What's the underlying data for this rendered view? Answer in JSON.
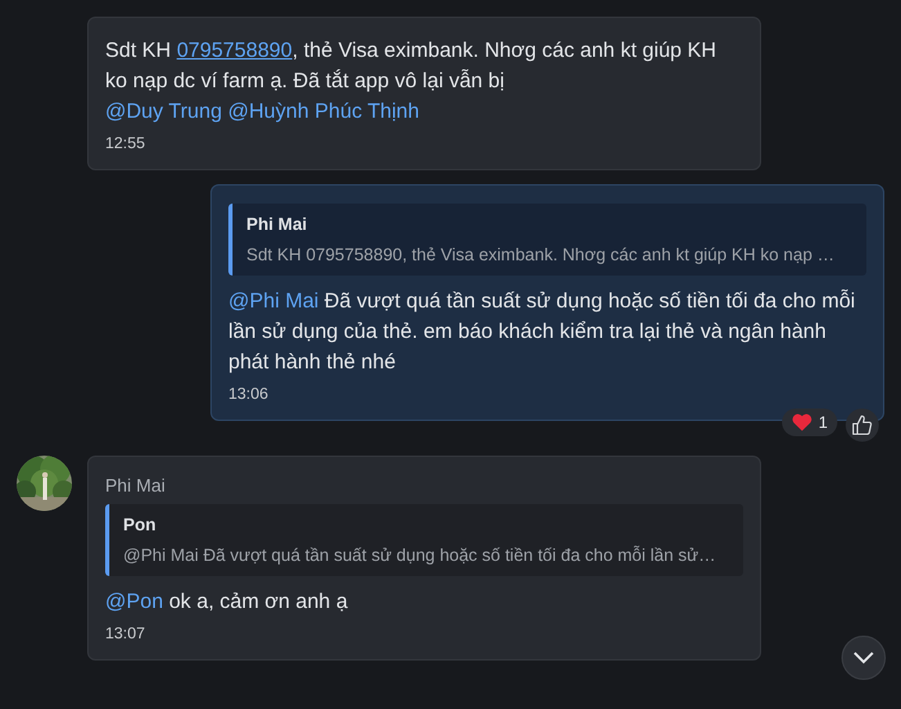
{
  "messages": [
    {
      "kind": "incoming",
      "parts": [
        {
          "kind": "plain",
          "text": "Sdt KH "
        },
        {
          "kind": "link",
          "text": "0795758890"
        },
        {
          "kind": "plain",
          "text": ", thẻ Visa eximbank. Nhơg các anh kt giúp KH ko nạp dc ví farm ạ. Đã tắt app vô lại vẫn bị "
        },
        {
          "kind": "mention",
          "text": "@Duy Trung"
        },
        {
          "kind": "mention",
          "text": "@Huỳnh Phúc Thịnh"
        }
      ],
      "time": "12:55"
    },
    {
      "kind": "outgoing",
      "quote": {
        "author": "Phi Mai",
        "text": "Sdt KH 0795758890, thẻ Visa eximbank. Nhơg các anh kt giúp KH ko nạp …"
      },
      "parts": [
        {
          "kind": "mention",
          "text": "@Phi Mai"
        },
        {
          "kind": "plain",
          "text": " Đã vượt quá tần suất sử dụng hoặc số tiền tối đa cho mỗi lần sử dụng của thẻ. em báo khách kiểm tra lại thẻ và ngân hành phát hành thẻ nhé"
        }
      ],
      "time": "13:06",
      "reactions": [
        {
          "kind": "heart",
          "count": "1"
        }
      ]
    },
    {
      "kind": "incoming",
      "avatar": {
        "kind": "picture"
      },
      "sender": "Phi Mai",
      "quote": {
        "author": "Pon",
        "text": "@Phi Mai Đã vượt quá tần suất sử dụng hoặc số tiền tối đa cho mỗi lần sử…"
      },
      "parts": [
        {
          "kind": "mention",
          "text": "@Pon"
        },
        {
          "kind": "plain",
          "text": " ok a, cảm ơn anh ạ"
        }
      ],
      "time": "13:07"
    }
  ]
}
